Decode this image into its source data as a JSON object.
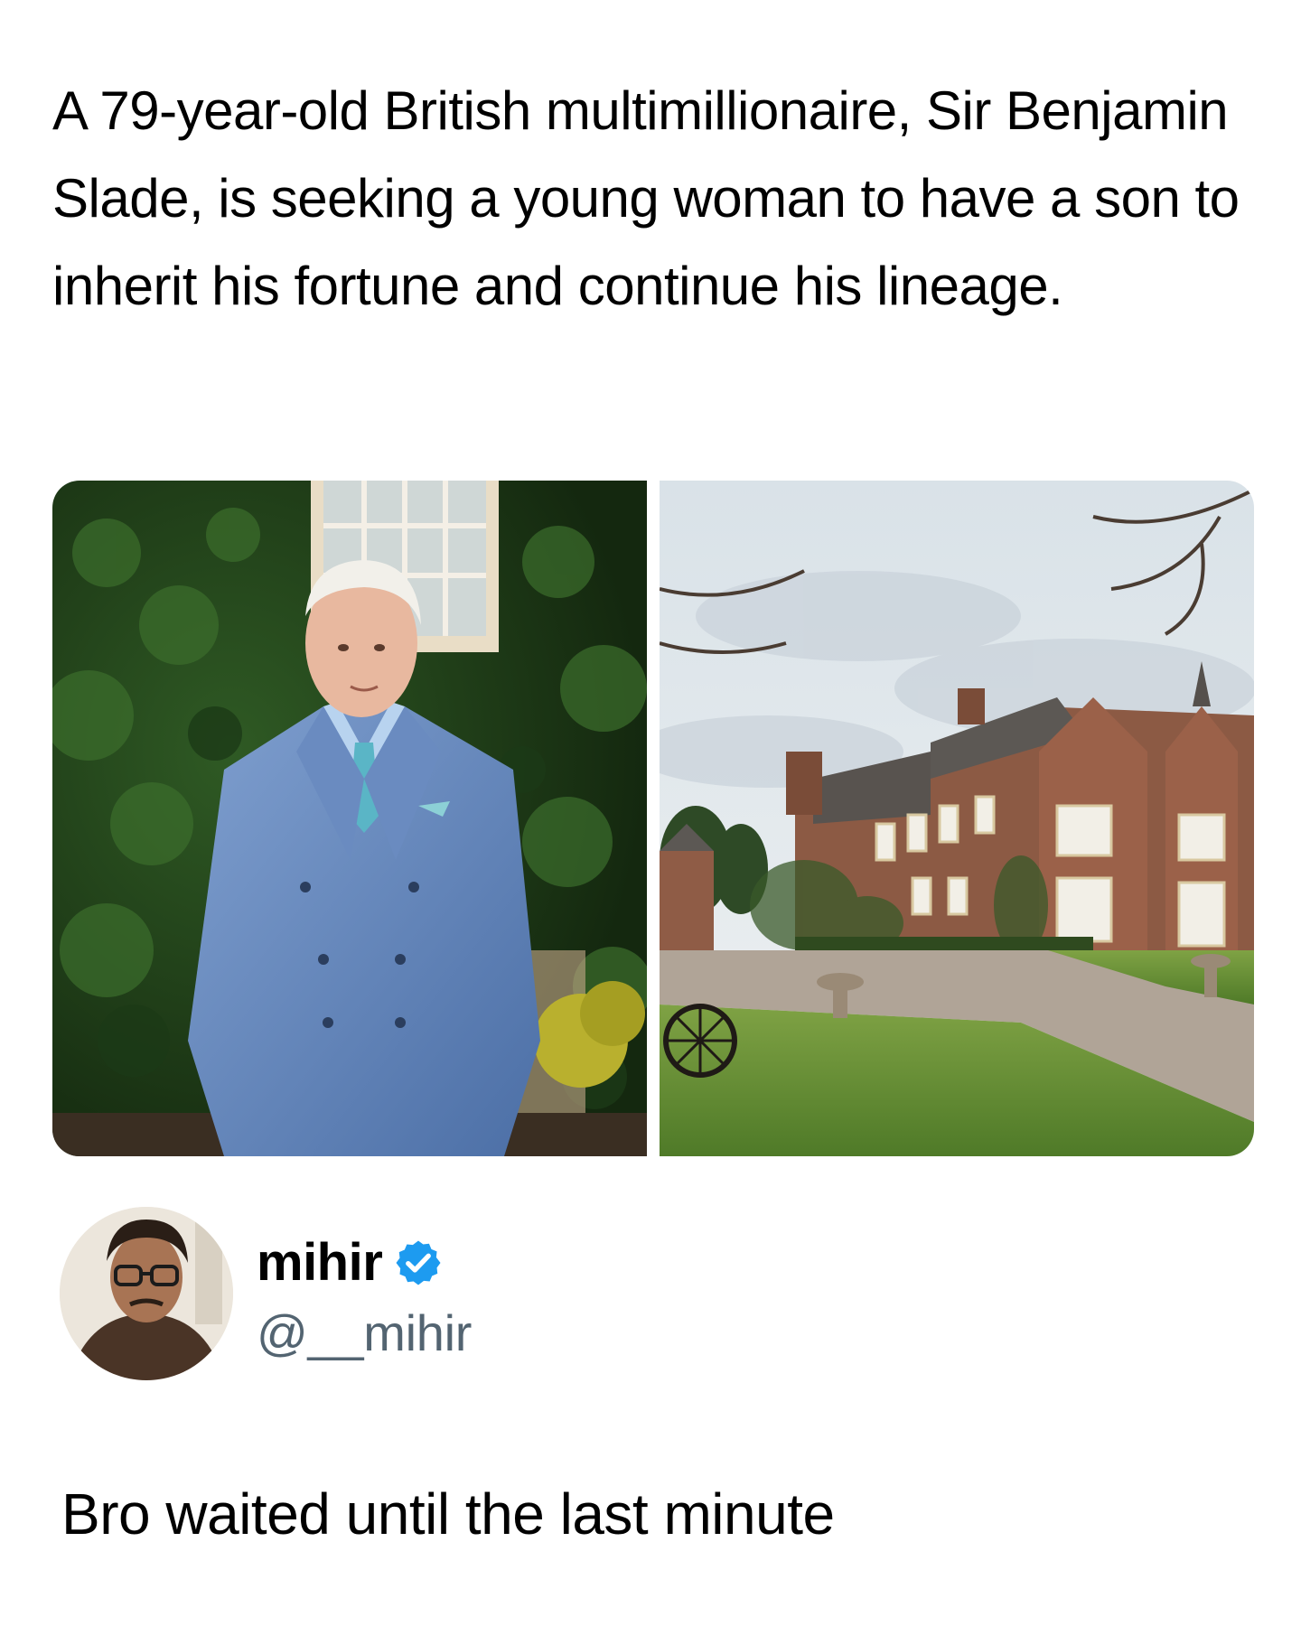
{
  "post": {
    "headline": "A 79-year-old British multimillionaire, Sir Benjamin Slade, is seeking a young woman to have a son to inherit his fortune and continue his lineage."
  },
  "media": [
    {
      "icon": "photo-elderly-man-blue-suit"
    },
    {
      "icon": "photo-manor-house"
    }
  ],
  "author": {
    "display_name": "mihir",
    "handle": "@__mihir",
    "verified": true,
    "verified_color": "#1d9bf0"
  },
  "reply": {
    "text": "Bro waited until the last minute"
  }
}
